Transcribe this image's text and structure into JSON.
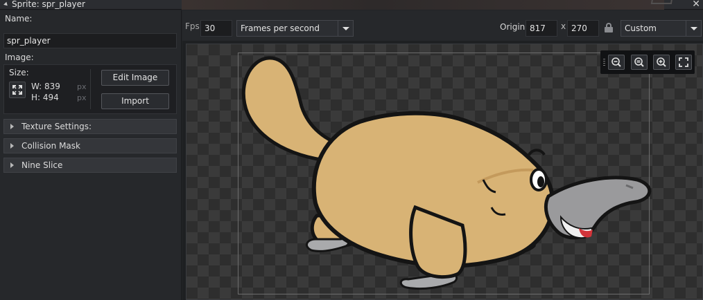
{
  "window": {
    "title": "Sprite: spr_player"
  },
  "left_panel": {
    "name_label": "Name:",
    "name_value": "spr_player",
    "image_label": "Image:",
    "size_label": "Size:",
    "width_text": "W: 839",
    "height_text": "H: 494",
    "unit": "px",
    "edit_image_label": "Edit Image",
    "import_label": "Import",
    "sections": [
      {
        "label": "Texture Settings:"
      },
      {
        "label": "Collision Mask"
      },
      {
        "label": "Nine Slice"
      }
    ]
  },
  "toolbar": {
    "fps_label": "Fps",
    "fps_value": "30",
    "speed_mode": "Frames per second",
    "origin_label": "Origin",
    "origin_x": "817",
    "origin_sep": "x",
    "origin_y": "270",
    "origin_preset": "Custom"
  },
  "zoom_controls": [
    {
      "icon": "zoom-out-icon"
    },
    {
      "icon": "zoom-reset-icon"
    },
    {
      "icon": "zoom-in-icon"
    },
    {
      "icon": "fit-to-window-icon"
    }
  ],
  "colors": {
    "accent_background": "#26282b",
    "platypus_body": "#d8b375",
    "platypus_bill": "#9a9a9c",
    "outline": "#141414"
  }
}
